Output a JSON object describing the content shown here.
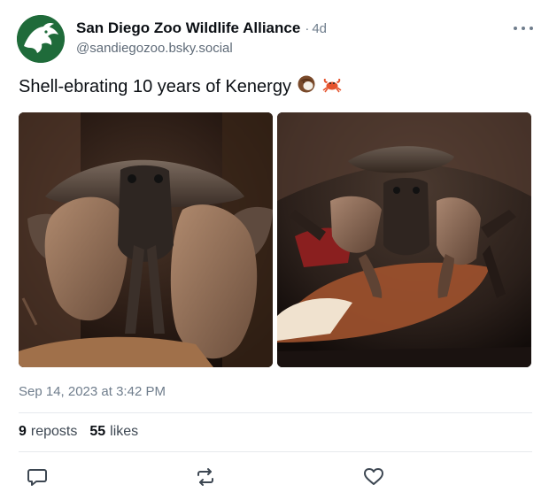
{
  "post": {
    "author": {
      "display_name": "San Diego Zoo Wildlife Alliance",
      "handle": "@sandiegozoo.bsky.social",
      "avatar_icon": "zoo-logo-icon",
      "avatar_color": "#1f6b3a"
    },
    "separator": "·",
    "age": "4d",
    "text": "Shell-ebrating 10 years of Kenergy",
    "emojis": [
      "coconut-emoji",
      "crab-emoji"
    ],
    "images": [
      {
        "name": "coconut-crab-closeup"
      },
      {
        "name": "coconut-crab-eating"
      }
    ],
    "timestamp": "Sep 14, 2023 at 3:42 PM",
    "stats": {
      "reposts_count": "9",
      "reposts_label": "reposts",
      "likes_count": "55",
      "likes_label": "likes"
    },
    "actions": [
      "reply-icon",
      "repost-icon",
      "like-icon",
      "more-icon"
    ]
  },
  "colors": {
    "text": "#0b0f14",
    "muted": "#6f7d8c",
    "divider": "#e6e9ed"
  }
}
